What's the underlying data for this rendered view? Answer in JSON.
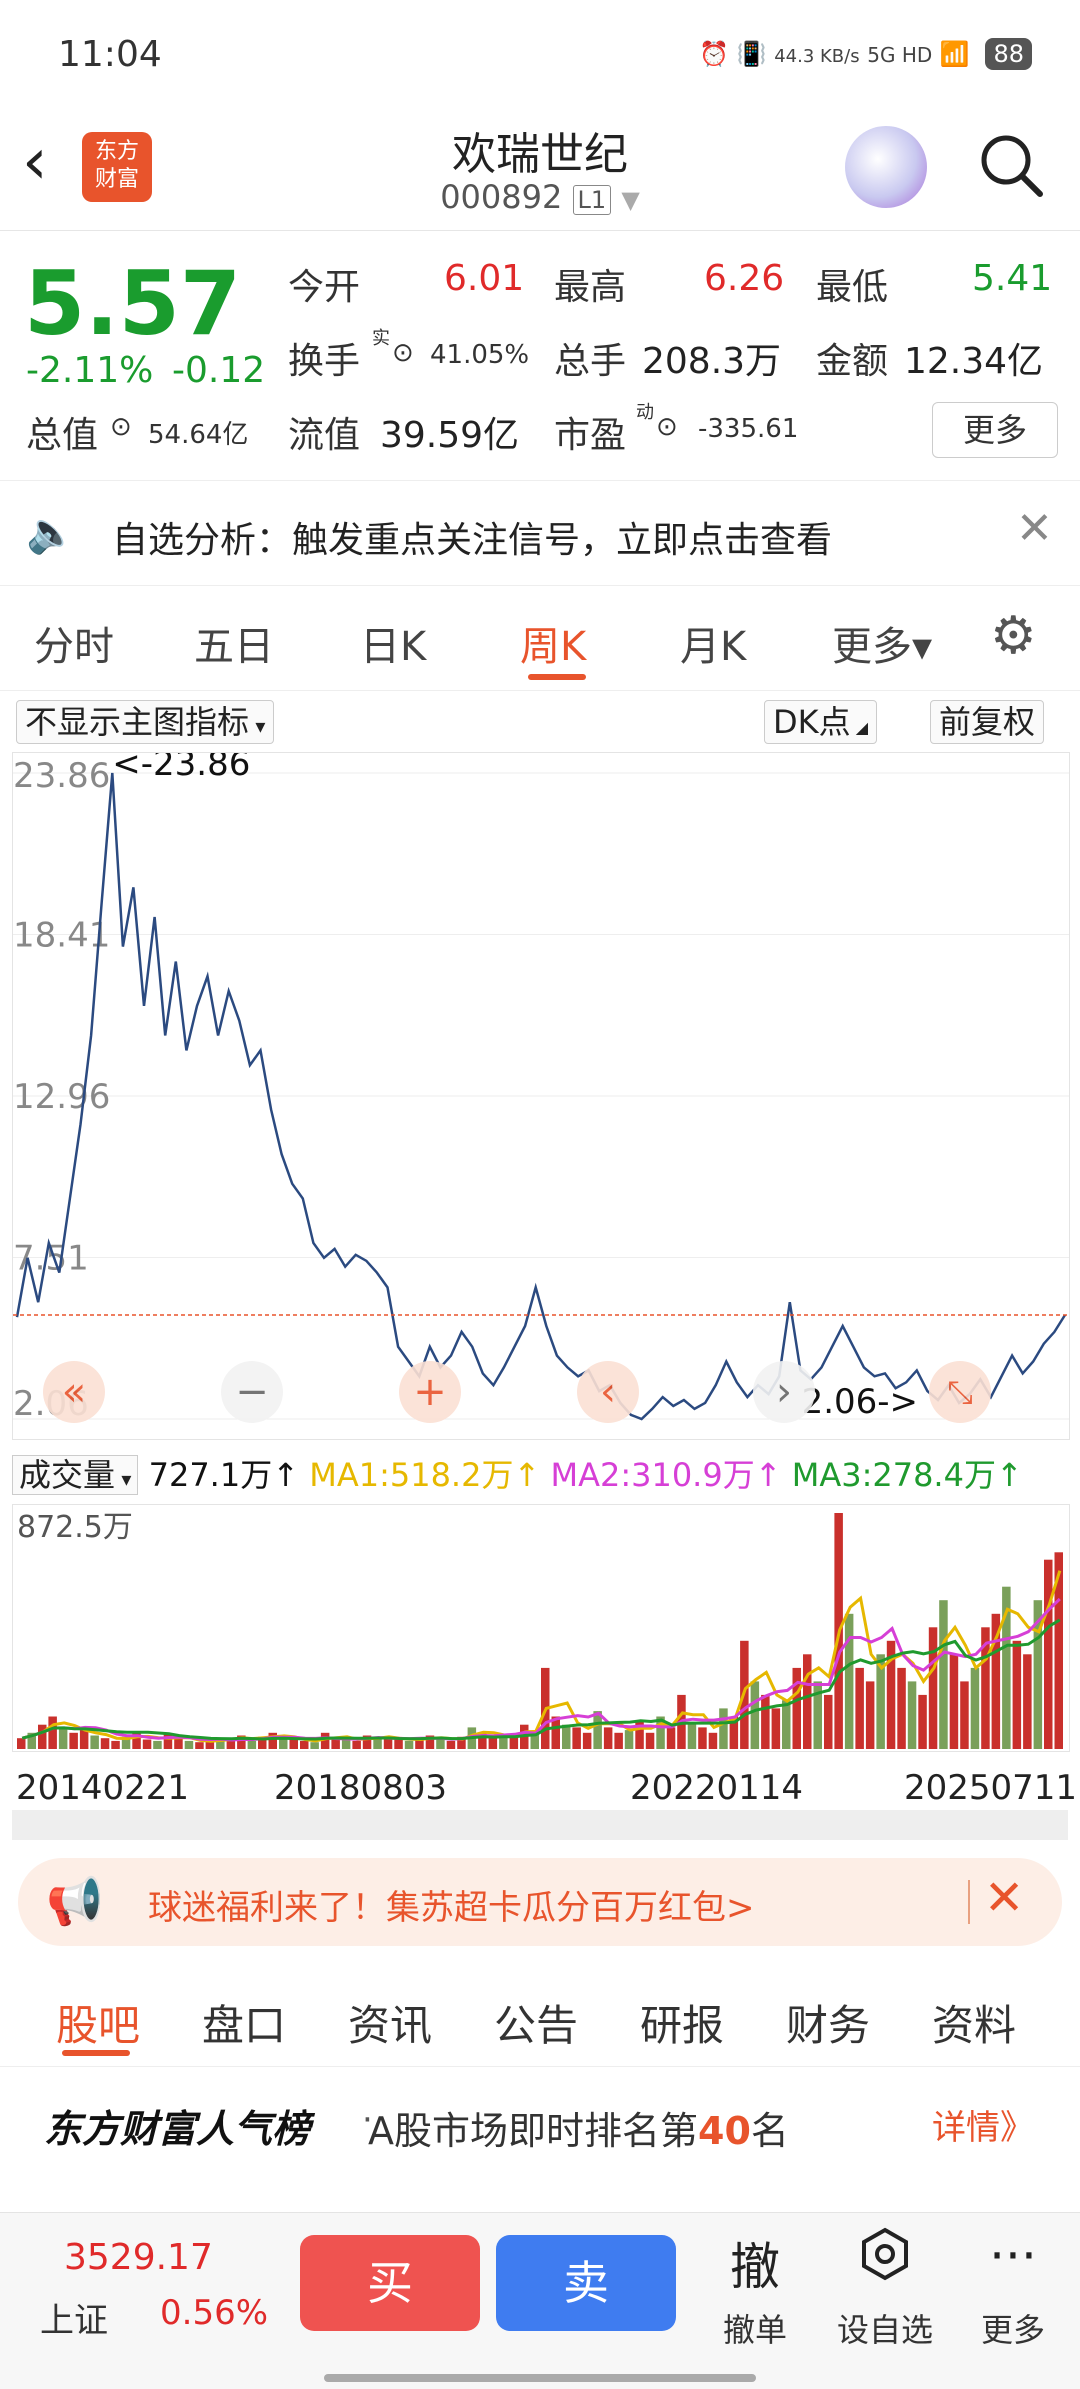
{
  "status_bar": {
    "time": "11:04",
    "net_speed": "44.3 KB/s",
    "signal": "5G HD",
    "battery": "88"
  },
  "header": {
    "logo_text_1": "东方",
    "logo_text_2": "财富",
    "stock_name": "欢瑞世纪",
    "stock_code": "000892",
    "level": "L1"
  },
  "quote": {
    "price": "5.57",
    "change_pct": "-2.11%",
    "change": "-0.12",
    "open_label": "今开",
    "open": "6.01",
    "high_label": "最高",
    "high": "6.26",
    "low_label": "最低",
    "low": "5.41",
    "turnover_label": "换手",
    "turnover_sup": "实",
    "turnover": "41.05%",
    "volume_label": "总手",
    "volume": "208.3万",
    "amount_label": "金额",
    "amount": "12.34亿",
    "mcap_label": "总值",
    "mcap": "54.64亿",
    "float_label": "流值",
    "float_cap": "39.59亿",
    "pe_label": "市盈",
    "pe_sup": "动",
    "pe": "-335.61",
    "more_label": "更多"
  },
  "notice": {
    "text": "自选分析：触发重点关注信号，立即点击查看"
  },
  "tabs": [
    {
      "label": "分时"
    },
    {
      "label": "五日"
    },
    {
      "label": "日K"
    },
    {
      "label": "周K"
    },
    {
      "label": "月K"
    },
    {
      "label": "更多▾"
    }
  ],
  "chart_options": {
    "indicator": "不显示主图指标",
    "dk": "DK点",
    "adjust": "前复权"
  },
  "chart_data": {
    "type": "line",
    "title": "",
    "y_ticks": [
      "23.86",
      "18.41",
      "12.96",
      "7.51",
      "2.06"
    ],
    "ylim": [
      2.06,
      23.86
    ],
    "max_annotation": "<-23.86",
    "min_annotation": "2.06->",
    "current_price_line": 5.57,
    "x_labels": [
      "20140221",
      "20180803",
      "20220114",
      "20250711"
    ],
    "values": [
      5.5,
      7.5,
      6.0,
      8.0,
      7.0,
      9.5,
      12.0,
      15.0,
      19.5,
      23.86,
      18.0,
      20.0,
      16.0,
      19.0,
      15.0,
      17.5,
      14.5,
      16.0,
      17.0,
      15.0,
      16.5,
      15.5,
      14.0,
      14.5,
      12.5,
      11.0,
      10.0,
      9.5,
      8.0,
      7.5,
      7.8,
      7.2,
      7.6,
      7.4,
      7.0,
      6.5,
      4.5,
      4.0,
      3.5,
      4.5,
      3.8,
      4.2,
      5.0,
      4.5,
      3.6,
      3.2,
      3.8,
      4.5,
      5.2,
      6.5,
      5.2,
      4.2,
      3.8,
      3.5,
      3.7,
      3.0,
      3.2,
      2.6,
      2.2,
      2.06,
      2.4,
      2.8,
      2.5,
      2.7,
      2.4,
      2.6,
      3.2,
      4.0,
      3.3,
      2.8,
      3.2,
      2.9,
      3.5,
      6.0,
      3.7,
      3.4,
      3.8,
      4.5,
      5.2,
      4.5,
      3.8,
      3.5,
      3.6,
      3.1,
      3.3,
      3.7,
      3.0,
      2.7,
      3.2,
      2.6,
      2.9,
      3.4,
      2.8,
      3.5,
      4.2,
      3.6,
      4.0,
      4.6,
      5.0,
      5.57
    ],
    "volume": {
      "label": "成交量",
      "current": "727.1万",
      "ma1": "MA1:518.2万",
      "ma2": "MA2:310.9万",
      "ma3": "MA3:278.4万",
      "max_label": "872.5万",
      "max": 872.5,
      "values": [
        40,
        60,
        90,
        120,
        80,
        60,
        70,
        50,
        40,
        30,
        45,
        60,
        35,
        30,
        55,
        40,
        30,
        25,
        30,
        40,
        35,
        50,
        30,
        45,
        60,
        40,
        35,
        30,
        25,
        60,
        40,
        35,
        30,
        50,
        40,
        45,
        35,
        30,
        40,
        50,
        35,
        30,
        45,
        80,
        60,
        40,
        55,
        45,
        90,
        60,
        300,
        120,
        90,
        80,
        60,
        140,
        80,
        60,
        70,
        100,
        60,
        120,
        80,
        200,
        100,
        80,
        60,
        150,
        120,
        400,
        250,
        200,
        150,
        180,
        300,
        350,
        250,
        200,
        872.5,
        500,
        300,
        250,
        350,
        400,
        300,
        250,
        200,
        450,
        550,
        350,
        250,
        300,
        450,
        500,
        600,
        400,
        350,
        550,
        700,
        727.1
      ]
    },
    "ma_colors": {
      "ma1": "#e6b800",
      "ma2": "#d63fd6",
      "ma3": "#1f9a2e"
    }
  },
  "banner": {
    "text": "球迷福利来了！集苏超卡瓜分百万红包>"
  },
  "bottom_tabs": [
    {
      "label": "股吧"
    },
    {
      "label": "盘口"
    },
    {
      "label": "资讯"
    },
    {
      "label": "公告"
    },
    {
      "label": "研报"
    },
    {
      "label": "财务"
    },
    {
      "label": "资料"
    }
  ],
  "rank": {
    "brand": "东方财富人气榜",
    "text_prefix": "A股市场即时排名第",
    "rank_num": "40",
    "text_suffix": "名",
    "detail": "详情》"
  },
  "bottom_bar": {
    "index_value": "3529.17",
    "index_name": "上证",
    "index_pct": "0.56%",
    "buy": "买",
    "sell": "卖",
    "cancel_icon": "撤",
    "cancel_label": "撤单",
    "watch_label": "设自选",
    "more_label": "更多"
  },
  "colors": {
    "up": "#e02a2a",
    "down": "#1a9c2e",
    "accent": "#e8542c",
    "line": "#2b4a80",
    "buy": "#ef5350",
    "sell": "#3f7cf0"
  }
}
